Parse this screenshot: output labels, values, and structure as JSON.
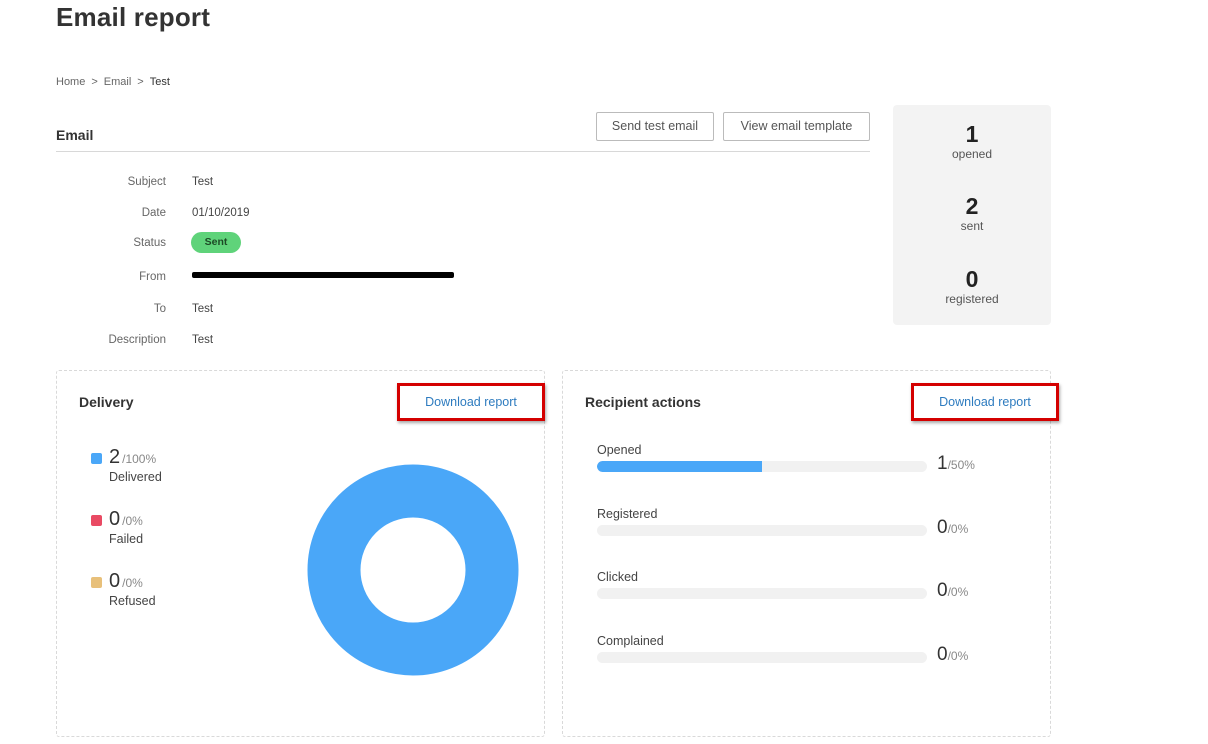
{
  "page": {
    "title": "Email report"
  },
  "breadcrumb": [
    {
      "label": "Home"
    },
    {
      "label": "Email"
    },
    {
      "label": "Test"
    }
  ],
  "breadcrumb_separator": ">",
  "email": {
    "heading": "Email",
    "send_test_label": "Send test email",
    "view_template_label": "View email template",
    "fields": {
      "subject": {
        "label": "Subject",
        "value": "Test"
      },
      "date": {
        "label": "Date",
        "value": "01/10/2019"
      },
      "status": {
        "label": "Status",
        "value": "Sent"
      },
      "from": {
        "label": "From"
      },
      "to": {
        "label": "To",
        "value": "Test"
      },
      "description": {
        "label": "Description",
        "value": "Test"
      }
    }
  },
  "stats": {
    "opened": {
      "value": "1",
      "label": "opened"
    },
    "sent": {
      "value": "2",
      "label": "sent"
    },
    "registered": {
      "value": "0",
      "label": "registered"
    }
  },
  "delivery": {
    "title": "Delivery",
    "download_label": "Download report",
    "items": [
      {
        "value": "2",
        "pct": "/100%",
        "label": "Delivered",
        "color": "#4aa7f8"
      },
      {
        "value": "0",
        "pct": "/0%",
        "label": "Failed",
        "color": "#e94a63"
      },
      {
        "value": "0",
        "pct": "/0%",
        "label": "Refused",
        "color": "#e8c07a"
      }
    ]
  },
  "actions": {
    "title": "Recipient actions",
    "download_label": "Download report",
    "items": [
      {
        "label": "Opened",
        "value": "1",
        "pct": "/50%",
        "fraction": 0.5
      },
      {
        "label": "Registered",
        "value": "0",
        "pct": "/0%",
        "fraction": 0
      },
      {
        "label": "Clicked",
        "value": "0",
        "pct": "/0%",
        "fraction": 0
      },
      {
        "label": "Complained",
        "value": "0",
        "pct": "/0%",
        "fraction": 0
      }
    ]
  },
  "chart_data": {
    "type": "pie",
    "categories": [
      "Delivered",
      "Failed",
      "Refused"
    ],
    "values": [
      2,
      0,
      0
    ],
    "colors": [
      "#4aa7f8",
      "#e94a63",
      "#e8c07a"
    ],
    "title": ""
  },
  "colors": {
    "accent": "#4aa7f8",
    "badge_sent": "#5fd37a",
    "highlight_border": "#d40000",
    "link": "#2d7bbf"
  }
}
